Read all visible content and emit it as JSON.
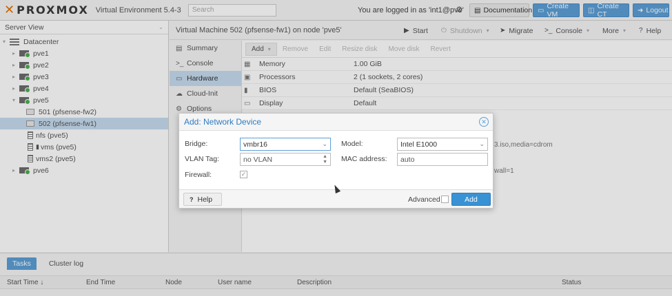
{
  "header": {
    "logo": "PROXMOX",
    "version": "Virtual Environment 5.4-3",
    "search_placeholder": "Search",
    "logged_in": "You are logged in as 'int1@pve'",
    "documentation": "Documentation",
    "create_vm": "Create VM",
    "create_ct": "Create CT",
    "logout": "Logout"
  },
  "tree": {
    "view": "Server View",
    "datacenter": "Datacenter",
    "nodes": [
      "pve1",
      "pve2",
      "pve3",
      "pve4",
      "pve5"
    ],
    "vms": [
      "501 (pfsense-fw2)",
      "502 (pfsense-fw1)"
    ],
    "storage": [
      "nfs (pve5)",
      "vms (pve5)",
      "vms2 (pve5)"
    ],
    "last_node": "pve6"
  },
  "vm": {
    "title": "Virtual Machine 502 (pfsense-fw1) on node 'pve5'",
    "start": "Start",
    "shutdown": "Shutdown",
    "migrate": "Migrate",
    "console": "Console",
    "more": "More",
    "help": "Help"
  },
  "submenu": [
    "Summary",
    "Console",
    "Hardware",
    "Cloud-Init",
    "Options"
  ],
  "hardware_toolbar": [
    "Add",
    "Remove",
    "Edit",
    "Resize disk",
    "Move disk",
    "Revert"
  ],
  "hardware": [
    {
      "key": "Memory",
      "value": "1.00 GiB"
    },
    {
      "key": "Processors",
      "value": "2 (1 sockets, 2 cores)"
    },
    {
      "key": "BIOS",
      "value": "Default (SeaBIOS)"
    },
    {
      "key": "Display",
      "value": "Default"
    }
  ],
  "fragments": {
    "cdrom": "3.iso,media=cdrom",
    "firewall": "wall=1"
  },
  "tasks": {
    "tab_tasks": "Tasks",
    "tab_cluster": "Cluster log",
    "columns": [
      "Start Time ↓",
      "End Time",
      "Node",
      "User name",
      "Description",
      "Status"
    ]
  },
  "dialog": {
    "title": "Add: Network Device",
    "bridge_label": "Bridge:",
    "bridge_value": "vmbr16",
    "vlan_label": "VLAN Tag:",
    "vlan_value": "no VLAN",
    "firewall_label": "Firewall:",
    "model_label": "Model:",
    "model_value": "Intel E1000",
    "mac_label": "MAC address:",
    "mac_value": "auto",
    "help": "Help",
    "advanced": "Advanced",
    "add": "Add"
  }
}
